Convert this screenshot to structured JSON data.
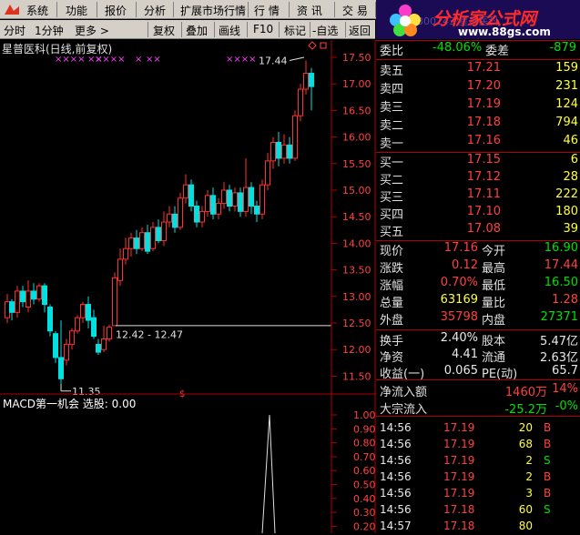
{
  "menu": [
    "系统",
    "功能",
    "报价",
    "分析",
    "扩展市场行情",
    "行 情",
    "资 讯",
    "交 易",
    "网"
  ],
  "period_tabs": [
    "分时",
    "1分钟",
    "更多 >"
  ],
  "toolbar": [
    "复权",
    "叠加",
    "画线",
    "F10",
    "标记",
    "-自选",
    "返回"
  ],
  "logo": {
    "text": "分析家公式网",
    "url": "www.88gs.com",
    "bg": "300143 星普医科"
  },
  "chart": {
    "title": "星普医科(日线,前复权)",
    "price_axis": [
      "17.50",
      "17.00",
      "16.50",
      "16.00",
      "15.50",
      "15.00",
      "14.50",
      "14.00",
      "13.50",
      "13.00",
      "12.50",
      "12.00",
      "11.50"
    ],
    "annotations": {
      "high": "17.44",
      "low": "11.35",
      "range": "12.42 - 12.47"
    },
    "x_markers": [
      "××××",
      "××",
      "××××",
      "×",
      "××",
      "××××"
    ]
  },
  "macd": {
    "label": "MACD第一机会 选股: 0.00",
    "axis": [
      "1.00",
      "0.90",
      "0.80",
      "0.70",
      "0.60",
      "0.50",
      "0.40",
      "0.30",
      "0.20",
      "0.10"
    ]
  },
  "quote": {
    "weibi": {
      "label": "委比",
      "value": "-48.06%",
      "label2": "委差",
      "value2": "-879"
    },
    "asks": [
      {
        "label": "卖五",
        "price": "17.21",
        "vol": "159"
      },
      {
        "label": "卖四",
        "price": "17.20",
        "vol": "231"
      },
      {
        "label": "卖三",
        "price": "17.19",
        "vol": "124"
      },
      {
        "label": "卖二",
        "price": "17.18",
        "vol": "794"
      },
      {
        "label": "卖一",
        "price": "17.16",
        "vol": "46"
      }
    ],
    "bids": [
      {
        "label": "买一",
        "price": "17.15",
        "vol": "6"
      },
      {
        "label": "买二",
        "price": "17.12",
        "vol": "28"
      },
      {
        "label": "买三",
        "price": "17.11",
        "vol": "222"
      },
      {
        "label": "买四",
        "price": "17.10",
        "vol": "180"
      },
      {
        "label": "买五",
        "price": "17.08",
        "vol": "39"
      }
    ],
    "stats": [
      {
        "l1": "现价",
        "v1": "17.16",
        "c1": "red",
        "l2": "今开",
        "v2": "16.90",
        "c2": "green"
      },
      {
        "l1": "涨跌",
        "v1": "0.12",
        "c1": "red",
        "l2": "最高",
        "v2": "17.44",
        "c2": "red"
      },
      {
        "l1": "涨幅",
        "v1": "0.70%",
        "c1": "red",
        "l2": "最低",
        "v2": "16.50",
        "c2": "green"
      },
      {
        "l1": "总量",
        "v1": "63169",
        "c1": "yellow",
        "l2": "量比",
        "v2": "1.28",
        "c2": "red"
      },
      {
        "l1": "外盘",
        "v1": "35798",
        "c1": "red",
        "l2": "内盘",
        "v2": "27371",
        "c2": "green"
      }
    ],
    "stats2": [
      {
        "l1": "换手",
        "v1": "2.40%",
        "c1": "white",
        "l2": "股本",
        "v2": "5.47亿",
        "c2": "white"
      },
      {
        "l1": "净资",
        "v1": "4.41",
        "c1": "white",
        "l2": "流通",
        "v2": "2.63亿",
        "c2": "white"
      },
      {
        "l1": "收益(一)",
        "v1": "0.065",
        "c1": "white",
        "l2": "PE(动)",
        "v2": "65.7",
        "c2": "white"
      }
    ],
    "flow": [
      {
        "label": "净流入额",
        "v1": "1460万",
        "c1": "red",
        "v2": "14%",
        "c2": "red"
      },
      {
        "label": "大宗流入",
        "v1": "-25.2万",
        "c1": "green",
        "v2": "-0%",
        "c2": "green"
      }
    ],
    "ticks": [
      {
        "time": "14:56",
        "price": "17.19",
        "vol": "20",
        "side": "B"
      },
      {
        "time": "14:56",
        "price": "17.19",
        "vol": "68",
        "side": "B"
      },
      {
        "time": "14:56",
        "price": "17.19",
        "vol": "2",
        "side": "S"
      },
      {
        "time": "14:56",
        "price": "17.19",
        "vol": "2",
        "side": "B"
      },
      {
        "time": "14:56",
        "price": "17.19",
        "vol": "3",
        "side": "B"
      },
      {
        "time": "14:56",
        "price": "17.18",
        "vol": "60",
        "side": "S"
      },
      {
        "time": "14:57",
        "price": "17.18",
        "vol": "80",
        "side": ""
      }
    ]
  }
}
